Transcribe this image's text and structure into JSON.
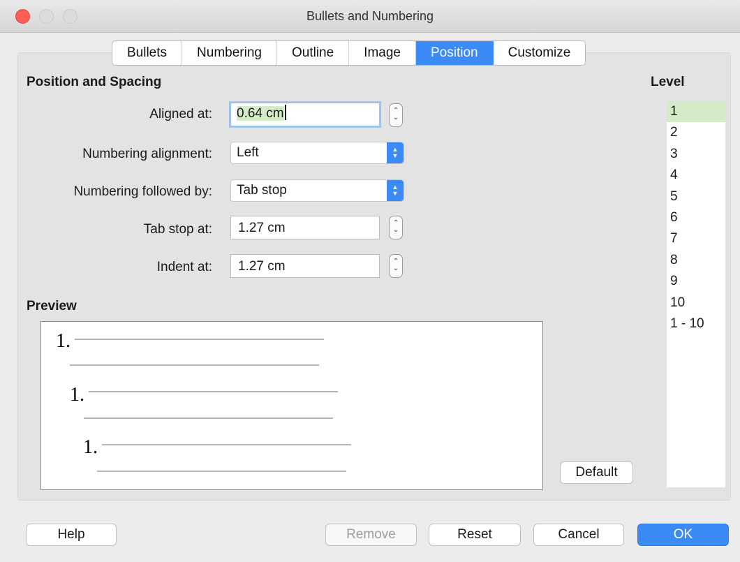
{
  "window": {
    "title": "Bullets and Numbering"
  },
  "tabs": [
    "Bullets",
    "Numbering",
    "Outline",
    "Image",
    "Position",
    "Customize"
  ],
  "active_tab": "Position",
  "position_spacing": {
    "heading": "Position and Spacing",
    "aligned_at": {
      "label": "Aligned at:",
      "value": "0.64 cm"
    },
    "numbering_alignment": {
      "label": "Numbering alignment:",
      "value": "Left"
    },
    "numbering_followed_by": {
      "label": "Numbering followed by:",
      "value": "Tab stop"
    },
    "tab_stop_at": {
      "label": "Tab stop at:",
      "value": "1.27 cm"
    },
    "indent_at": {
      "label": "Indent at:",
      "value": "1.27 cm"
    }
  },
  "preview": {
    "heading": "Preview",
    "numbers": [
      "1.",
      "1.",
      "1."
    ]
  },
  "default_button": "Default",
  "level": {
    "heading": "Level",
    "items": [
      "1",
      "2",
      "3",
      "4",
      "5",
      "6",
      "7",
      "8",
      "9",
      "10",
      "1 - 10"
    ],
    "selected": "1"
  },
  "footer": {
    "help": "Help",
    "remove": "Remove",
    "reset": "Reset",
    "cancel": "Cancel",
    "ok": "OK"
  },
  "colors": {
    "accent": "#3b8af5",
    "selection": "#d3ebc7",
    "close": "#fd5f57"
  }
}
